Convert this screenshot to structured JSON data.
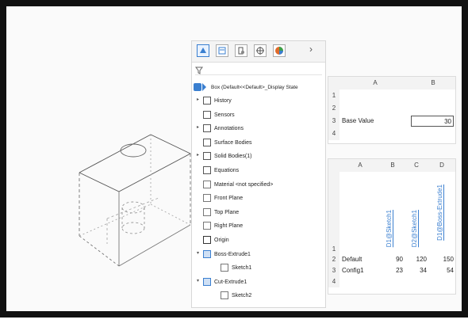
{
  "tree": {
    "root_label": "Box (Default<<Default>_Display State",
    "items": [
      {
        "label": "History",
        "expandable": true
      },
      {
        "label": "Sensors",
        "expandable": false
      },
      {
        "label": "Annotations",
        "expandable": true
      },
      {
        "label": "Surface Bodies",
        "expandable": false
      },
      {
        "label": "Solid Bodies(1)",
        "expandable": true
      },
      {
        "label": "Equations",
        "expandable": false
      },
      {
        "label": "Material <not specified>",
        "expandable": false
      },
      {
        "label": "Front Plane",
        "expandable": false
      },
      {
        "label": "Top Plane",
        "expandable": false
      },
      {
        "label": "Right Plane",
        "expandable": false
      },
      {
        "label": "Origin",
        "expandable": false
      },
      {
        "label": "Boss-Extrude1",
        "expandable": true,
        "expanded": true
      },
      {
        "label": "Sketch1",
        "child": true
      },
      {
        "label": "Cut-Extrude1",
        "expandable": true,
        "expanded": true
      },
      {
        "label": "Sketch2",
        "child": true
      }
    ],
    "tab_more": "›"
  },
  "sheet1": {
    "col_headers": [
      "A",
      "B"
    ],
    "row_headers": [
      "1",
      "2",
      "3",
      "4"
    ],
    "base_label": "Base Value",
    "base_value": "30"
  },
  "sheet2": {
    "col_headers": [
      "A",
      "B",
      "C",
      "D"
    ],
    "row_headers": [
      "1",
      "2",
      "3",
      "4"
    ],
    "vertical_headers": [
      "D1@Sketch1",
      "D2@Sketch1",
      "D1@Boss-Extrude1"
    ],
    "rows": [
      {
        "name": "Default",
        "values": [
          "90",
          "120",
          "150"
        ]
      },
      {
        "name": "Config1",
        "values": [
          "23",
          "34",
          "54"
        ]
      }
    ]
  },
  "colors": {
    "accent": "#3a7fd0",
    "frame": "#111111"
  }
}
